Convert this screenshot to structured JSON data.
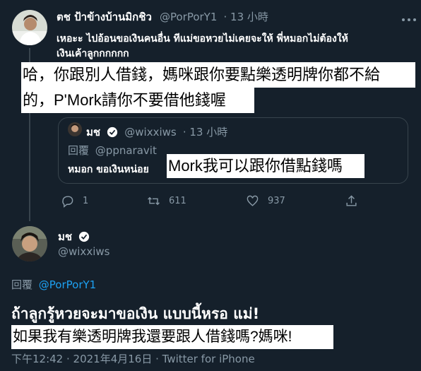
{
  "tweet": {
    "author_name": "ตช ป้าข้างบ้านมิกชิว",
    "author_handle": "@PorPorY1",
    "timestamp": "· 13 小時",
    "text_line1": "เหอะะ ไปอ้อนขอเงินคนอื่น ทีแม่ขอหวยไม่เคยจะให้ พี่หมอกไม่ต้องให้",
    "text_line2": "เงินเค้าลูกกกกกก",
    "caption_line1": "哈，你跟別人借錢，媽咪跟你要點樂透明牌你都不給",
    "caption_line2": "的，P'Mork請你不要借他錢喔",
    "quote": {
      "author_name": "มช",
      "author_handle": "@wixxiws",
      "timestamp": "· 13 小時",
      "reply_to_label": "回覆",
      "reply_to_handle": "@ppnaravit",
      "text": "หมอก ขอเงินหน่อย",
      "caption": "Mork我可以跟你借點錢嗎"
    },
    "actions": {
      "reply_count": "1",
      "retweet_count": "611",
      "like_count": "937"
    }
  },
  "main_tweet": {
    "author_name": "มช",
    "author_handle": "@wixxiws",
    "reply_to_label": "回覆",
    "reply_to_handle": "@PorPorY1",
    "text": "ถ้าลูกรู้หวยจะมาขอเงิน แบบนี้หรอ แม่!",
    "caption": "如果我有樂透明牌我還要跟人借錢嗎?媽咪!",
    "timestamp": "下午12:42 · 2021年4月16日 · Twitter for iPhone"
  },
  "colors": {
    "background": "#15202b",
    "border": "#38444d",
    "muted": "#8899a6",
    "verified": "#ffffff",
    "link": "#1da1f2"
  },
  "icons": [
    "more-icon",
    "verified-icon",
    "reply-icon",
    "retweet-icon",
    "like-icon",
    "share-icon"
  ]
}
